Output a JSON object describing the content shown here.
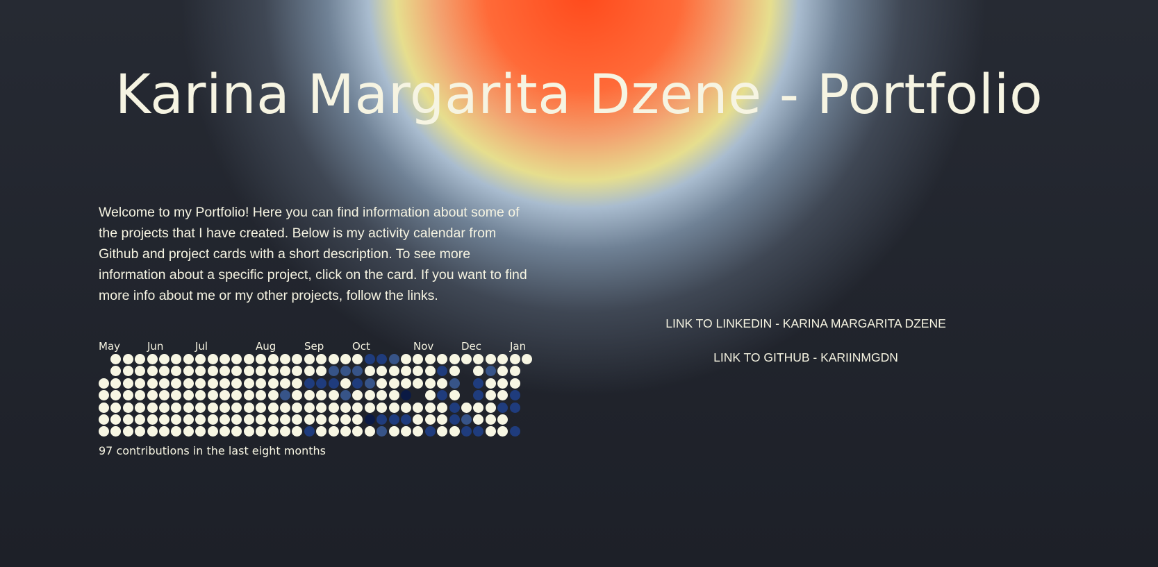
{
  "header": {
    "title": "Karina Margarita Dzene - Portfolio"
  },
  "intro": {
    "text": "Welcome to my Portfolio! Here you can find information about some of the projects that I have created. Below is my activity calendar from Github and project cards with a short description. To see more information about a specific project, click on the card. If you want to find more info about me or my other projects, follow the links."
  },
  "activity_calendar": {
    "months": [
      "May",
      "Jun",
      "Jul",
      "Aug",
      "Sep",
      "Oct",
      "Nov",
      "Dec",
      "Jan"
    ],
    "caption": "97 contributions in the last eight months",
    "colors": {
      "empty": "#f7f6e3",
      "level1": "#375488",
      "level2": "#1f3c7d",
      "level3": "#122a66",
      "level4": "#0b1a44"
    }
  },
  "links": {
    "linkedin": "LINK TO LINKEDIN - KARINA MARGARITA DZENE",
    "github": "LINK TO GITHUB - KARIINMGDN"
  },
  "colors": {
    "background": "#22262f",
    "text": "#f6f4e2",
    "glow_core": "#ff4a1c"
  }
}
